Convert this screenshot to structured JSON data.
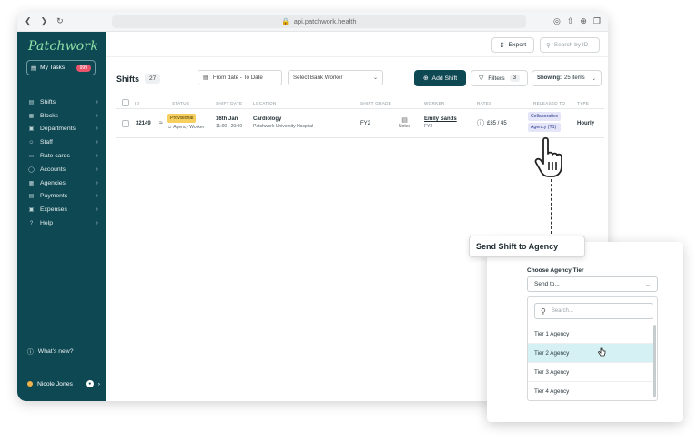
{
  "browser": {
    "url": "api.patchwork.health"
  },
  "sidebar": {
    "logo": "Patchwork",
    "tasks_label": "My Tasks",
    "tasks_badge": "999",
    "items": [
      {
        "label": "Shifts",
        "icon": "calendar-icon"
      },
      {
        "label": "Blocks",
        "icon": "blocks-icon"
      },
      {
        "label": "Departments",
        "icon": "building-icon"
      },
      {
        "label": "Staff",
        "icon": "staff-icon"
      },
      {
        "label": "Rate cards",
        "icon": "rate-card-icon"
      },
      {
        "label": "Accounts",
        "icon": "accounts-icon"
      },
      {
        "label": "Agencies",
        "icon": "agencies-icon"
      },
      {
        "label": "Payments",
        "icon": "payments-icon"
      },
      {
        "label": "Expenses",
        "icon": "expenses-icon"
      },
      {
        "label": "Help",
        "icon": "help-icon"
      }
    ],
    "whats_new": "What's new?",
    "user_name": "Nicole Jones"
  },
  "topbar": {
    "export_label": "Export",
    "search_placeholder": "Search by ID"
  },
  "toolbar": {
    "title": "Shifts",
    "count": "27",
    "date_range": "From date - To Date",
    "bank_worker_placeholder": "Select Bank Worker",
    "add_shift_label": "Add Shift",
    "filters_label": "Filters",
    "filters_count": "3",
    "showing_label": "Showing:",
    "showing_value": "25 items"
  },
  "table": {
    "headers": [
      "ID",
      "STATUS",
      "SHIFT DATE",
      "LOCATION",
      "SHIFT GRADE",
      "WORKER",
      "RATES",
      "RELEASED TO",
      "TYPE"
    ],
    "rows": [
      {
        "id": "32149",
        "status": "Provisional",
        "status_sub": "Agency Worker",
        "date": "16th Jan",
        "time": "11:00 - 20:00",
        "location": "Cardiology",
        "location_sub": "Patchwork University Hospital",
        "grade": "FY2",
        "notes": "Notes",
        "worker": "Emily Sands",
        "worker_sub": "FY2",
        "rates": "£35 / 45",
        "released_1": "Collaborative",
        "released_2": "Agency (T1)",
        "type": "Hourly"
      }
    ]
  },
  "panel": {
    "header": "Send Shift to Agency",
    "tier_label": "Choose Agency Tier",
    "select_value": "Send to...",
    "search_placeholder": "Search...",
    "options": [
      "Tier 1 Agency",
      "Tier 2 Agency",
      "Tier 3 Agency",
      "Tier 4 Agency"
    ],
    "selected_option": "Tier 2 Agency"
  },
  "colors": {
    "sidebar_bg": "#0e4853",
    "logo": "#8ee0a6",
    "provisional": "#f6cf5e",
    "selected_option_bg": "#d6f1f3",
    "badge": "#e8556b"
  }
}
